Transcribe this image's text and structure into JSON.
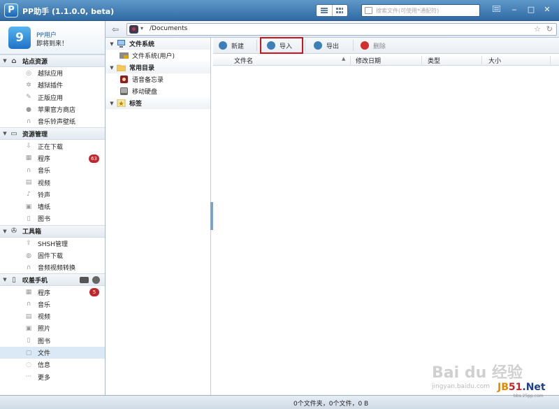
{
  "app": {
    "title": "PP助手 (1.1.0.0, beta)",
    "logo_letter": "P"
  },
  "search": {
    "placeholder": "搜索文件(可使用*通配符)"
  },
  "user": {
    "name": "PP用户",
    "welcome": "即将到来！",
    "avatar_letter": "9"
  },
  "sidebar": {
    "sections": [
      {
        "title": "站点资源",
        "items": [
          "越狱应用",
          "越狱插件",
          "正版应用",
          "苹果官方商店",
          "音乐铃声壁纸"
        ]
      },
      {
        "title": "资源管理",
        "items": [
          "正在下载",
          "程序",
          "音乐",
          "视频",
          "铃声",
          "墙纸",
          "图书"
        ],
        "badge_item": "程序",
        "badge": "63"
      },
      {
        "title": "工具箱",
        "items": [
          "SHSH管理",
          "固件下载",
          "音频视频转换"
        ]
      },
      {
        "title": "叹羞手机",
        "items": [
          "程序",
          "音乐",
          "视频",
          "照片",
          "图书",
          "文件",
          "信息",
          "更多"
        ],
        "badge_item": "程序",
        "badge": "5",
        "active": "文件"
      }
    ]
  },
  "address": {
    "path": "/Documents"
  },
  "tree": {
    "filesystem": "文件系统",
    "filesystem_user": "文件系统(用户)",
    "common": "常用目录",
    "voice_memo": "语音备忘录",
    "mobile_disk": "移动硬盘",
    "bookmarks": "标签"
  },
  "toolbar": {
    "new": "新建",
    "import": "导入",
    "export": "导出",
    "delete": "删除"
  },
  "columns": {
    "name": "文件名",
    "modified": "修改日期",
    "type": "类型",
    "size": "大小"
  },
  "status": "0个文件夹，0个文件，0 B",
  "watermark": {
    "baidu": "Bai du 经验",
    "url": "jingyan.baidu.com",
    "jb51_a": "JB",
    "jb51_b": "51",
    "jb51_c": ".Net",
    "jb51_sub": "bbs.25pp.com"
  },
  "colors": {
    "titlebar": "#2f6aa3",
    "highlight_border": "#c9161c",
    "badge": "#c0262b"
  }
}
